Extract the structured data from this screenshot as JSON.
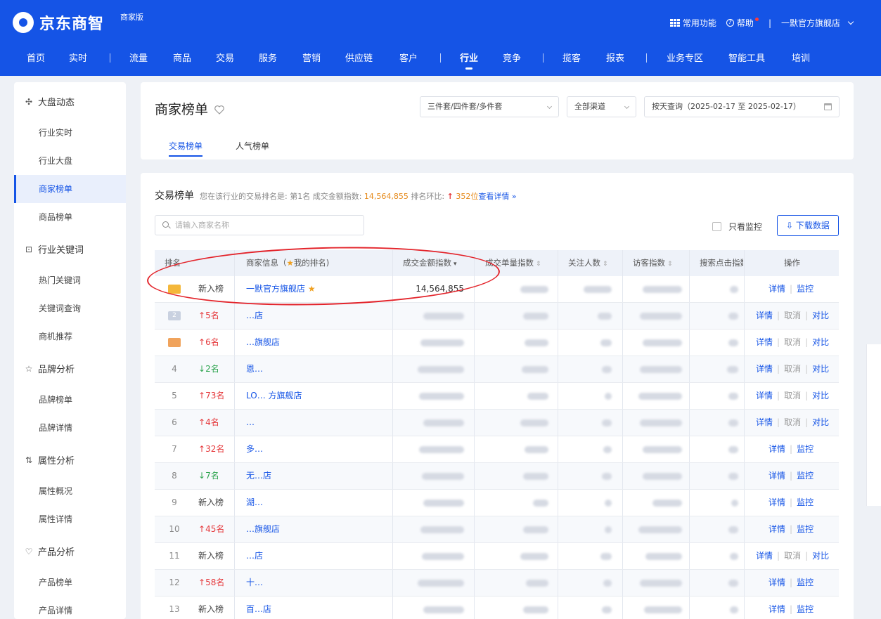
{
  "header": {
    "logo_text": "京东商智",
    "edition": "商家版",
    "common_functions": "常用功能",
    "help": "帮助",
    "separator": "|",
    "shop_name": "一默官方旗舰店"
  },
  "nav": [
    {
      "label": "首页"
    },
    {
      "label": "实时"
    },
    {
      "label": "流量"
    },
    {
      "label": "商品"
    },
    {
      "label": "交易"
    },
    {
      "label": "服务"
    },
    {
      "label": "营销"
    },
    {
      "label": "供应链"
    },
    {
      "label": "客户"
    },
    {
      "label": "行业"
    },
    {
      "label": "竞争"
    },
    {
      "label": "揽客"
    },
    {
      "label": "报表"
    },
    {
      "label": "业务专区"
    },
    {
      "label": "智能工具"
    },
    {
      "label": "培训"
    }
  ],
  "sidebar": {
    "groups": [
      {
        "title": "大盘动态",
        "icon": "market-icon",
        "items": [
          "行业实时",
          "行业大盘",
          "商家榜单",
          "商品榜单"
        ]
      },
      {
        "title": "行业关键词",
        "icon": "keyword-icon",
        "items": [
          "热门关键词",
          "关键词查询",
          "商机推荐"
        ]
      },
      {
        "title": "品牌分析",
        "icon": "brand-icon",
        "items": [
          "品牌榜单",
          "品牌详情"
        ]
      },
      {
        "title": "属性分析",
        "icon": "attribute-icon",
        "items": [
          "属性概况",
          "属性详情"
        ]
      },
      {
        "title": "产品分析",
        "icon": "product-icon",
        "items": [
          "产品榜单",
          "产品详情"
        ]
      }
    ],
    "active_item": "商家榜单"
  },
  "page": {
    "title": "商家榜单",
    "filter_package": "三件套/四件套/多件套",
    "filter_channel": "全部渠道",
    "filter_date": "按天查询（2025-02-17 至 2025-02-17）",
    "tabs": [
      "交易榜单",
      "人气榜单"
    ]
  },
  "ranking": {
    "title": "交易榜单",
    "desc_prefix": "您在该行业的交易排名是: 第1名 成交金额指数:",
    "desc_value": "14,564,855",
    "desc_ring": "排名环比:",
    "desc_ring_value": "352位",
    "desc_link": "查看详情 »",
    "search_placeholder": "请输入商家名称",
    "watch_only": "只看监控",
    "download": "下载数据",
    "columns": [
      "排名",
      "商家信息（",
      "我的排名)",
      "成交金额指数",
      "成交单量指数",
      "关注人数",
      "访客指数",
      "搜索点击指数",
      "操作"
    ],
    "op_detail": "详情",
    "op_monitor": "监控",
    "op_cancel": "取消",
    "op_compare": "对比",
    "rows": [
      {
        "rank": "1",
        "change": "新入榜",
        "change_type": "new",
        "name": "一默官方旗舰店",
        "amount": "14,564,855",
        "mine": true,
        "ops": "monitor"
      },
      {
        "rank": "2",
        "change": "5名",
        "change_type": "up",
        "name": "…店",
        "amount": "",
        "ops": "compare"
      },
      {
        "rank": "3",
        "change": "6名",
        "change_type": "up",
        "name": "…旗舰店",
        "amount": "",
        "ops": "compare"
      },
      {
        "rank": "4",
        "change": "2名",
        "change_type": "down",
        "name": "恩…",
        "amount": "",
        "ops": "compare"
      },
      {
        "rank": "5",
        "change": "73名",
        "change_type": "up",
        "name": "LO… 方旗舰店",
        "amount": "",
        "ops": "compare"
      },
      {
        "rank": "6",
        "change": "4名",
        "change_type": "up",
        "name": "…",
        "amount": "",
        "ops": "compare"
      },
      {
        "rank": "7",
        "change": "32名",
        "change_type": "up",
        "name": "多…",
        "amount": "",
        "ops": "monitor"
      },
      {
        "rank": "8",
        "change": "7名",
        "change_type": "down",
        "name": "无…店",
        "amount": "",
        "ops": "monitor"
      },
      {
        "rank": "9",
        "change": "新入榜",
        "change_type": "new",
        "name": "湖…",
        "amount": "",
        "ops": "monitor"
      },
      {
        "rank": "10",
        "change": "45名",
        "change_type": "up",
        "name": "…旗舰店",
        "amount": "",
        "ops": "monitor"
      },
      {
        "rank": "11",
        "change": "新入榜",
        "change_type": "new",
        "name": "…店",
        "amount": "",
        "ops": "compare"
      },
      {
        "rank": "12",
        "change": "58名",
        "change_type": "up",
        "name": "十…",
        "amount": "",
        "ops": "monitor"
      },
      {
        "rank": "13",
        "change": "新入榜",
        "change_type": "new",
        "name": "百…店",
        "amount": "",
        "ops": "monitor"
      }
    ]
  },
  "colors": {
    "brand_blue": "#1554e6",
    "up_red": "#e5383b",
    "down_green": "#2da44e",
    "highlight_orange": "#e68a1a"
  }
}
